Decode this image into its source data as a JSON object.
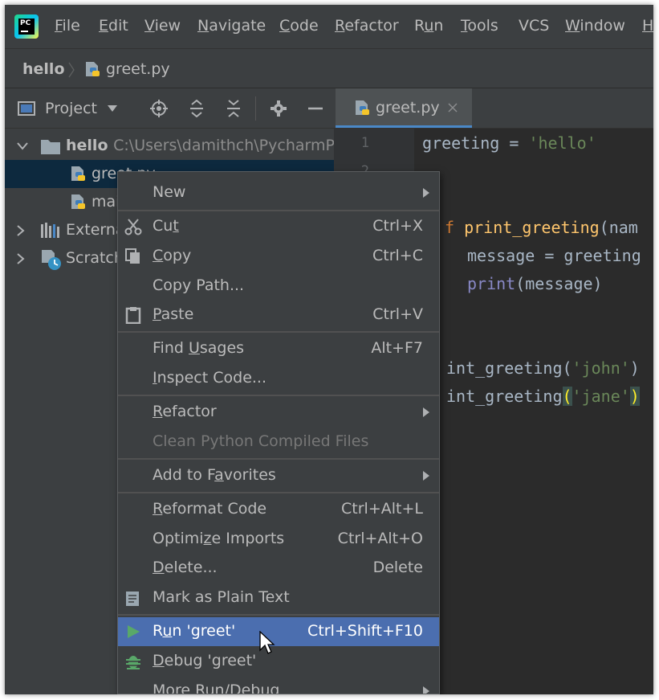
{
  "menubar": {
    "items": [
      {
        "pre": "",
        "u": "F",
        "post": "ile"
      },
      {
        "pre": "",
        "u": "E",
        "post": "dit"
      },
      {
        "pre": "",
        "u": "V",
        "post": "iew"
      },
      {
        "pre": "",
        "u": "N",
        "post": "avigate"
      },
      {
        "pre": "",
        "u": "C",
        "post": "ode"
      },
      {
        "pre": "",
        "u": "R",
        "post": "efactor"
      },
      {
        "pre": "R",
        "u": "u",
        "post": "n"
      },
      {
        "pre": "",
        "u": "T",
        "post": "ools"
      },
      {
        "pre": "VCS",
        "u": "",
        "post": ""
      },
      {
        "pre": "",
        "u": "W",
        "post": "indow"
      },
      {
        "pre": "",
        "u": "H",
        "post": ""
      }
    ]
  },
  "breadcrumb": {
    "project": "hello",
    "file": "greet.py"
  },
  "project_panel": {
    "title": "Project"
  },
  "editor_tab": {
    "label": "greet.py"
  },
  "tree": {
    "root_name": "hello",
    "root_path": "C:\\Users\\damithch\\PycharmPr",
    "file1": "greet.py",
    "file2": "mai",
    "external": "Externa",
    "scratches": "Scratch"
  },
  "editor": {
    "line_numbers": [
      "1",
      "2"
    ],
    "lines": {
      "l1_a": "greeting",
      "l1_b": " = ",
      "l1_c": "'hello'",
      "l3_kw": "f",
      "l3_fn": " print_greeting",
      "l3_rest": "(nam",
      "l4": "message = greeting",
      "l5_builtin": "print",
      "l5_rest": "(message)",
      "l7_a": "int_greeting(",
      "l7_str": "'john'",
      "l7_b": ")",
      "l8_a": "int_greeting",
      "l8_p1": "(",
      "l8_str": "'jane'",
      "l8_p2": ")"
    }
  },
  "context_menu": {
    "new": "New",
    "cut_pre": "Cu",
    "cut_u": "t",
    "cut_sc": "Ctrl+X",
    "copy_u": "C",
    "copy_post": "opy",
    "copy_sc": "Ctrl+C",
    "copy_path": "Copy Path...",
    "paste_u": "P",
    "paste_post": "aste",
    "paste_sc": "Ctrl+V",
    "find_pre": "Find ",
    "find_u": "U",
    "find_post": "sages",
    "find_sc": "Alt+F7",
    "inspect_u": "I",
    "inspect_post": "nspect Code...",
    "refactor_u": "R",
    "refactor_post": "efactor",
    "clean": "Clean Python Compiled Files",
    "favorites_pre": "Add to F",
    "favorites_u": "a",
    "favorites_post": "vorites",
    "reformat_u": "R",
    "reformat_post": "eformat Code",
    "reformat_sc": "Ctrl+Alt+L",
    "optimize_pre": "Optimi",
    "optimize_u": "z",
    "optimize_post": "e Imports",
    "optimize_sc": "Ctrl+Alt+O",
    "delete_u": "D",
    "delete_post": "elete...",
    "delete_sc": "Delete",
    "mark_plain": "Mark as Plain Text",
    "run_pre": "R",
    "run_u": "u",
    "run_post": "n 'greet'",
    "run_sc": "Ctrl+Shift+F10",
    "debug_u": "D",
    "debug_post": "ebug 'greet'",
    "more_run": "More Run/Debug"
  },
  "colors": {
    "background": "#3c3f41",
    "editor_bg": "#2b2b2b",
    "selection": "#0d293e",
    "menu_highlight": "#4b6eaf",
    "run_icon": "#59a869"
  }
}
